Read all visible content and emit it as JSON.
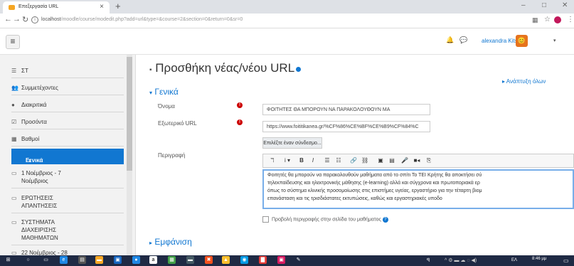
{
  "browser": {
    "tab_title": "Επεξεργασία URL",
    "tab_close": "×",
    "new_tab": "+",
    "url_main": "localhost",
    "url_rest": "/moodle/course/modedit.php?add=url&type=&course=2&section=0&return=0&sr=0",
    "win_min": "–",
    "win_max": "□",
    "win_close": "✕"
  },
  "navbar": {
    "user_name": "alexandra Kitsoy",
    "avatar_letter": "😊"
  },
  "sidebar": {
    "items": [
      {
        "icon": "☰",
        "label": "ΣΤ"
      },
      {
        "icon": "👥",
        "label": "Συμμετέχοντες"
      },
      {
        "icon": "●",
        "label": "Διακριτικά"
      },
      {
        "icon": "☑",
        "label": "Προσόντα"
      },
      {
        "icon": "▦",
        "label": "Βαθμοί"
      },
      {
        "icon": "▭",
        "label": "Γενικά"
      },
      {
        "icon": "▭",
        "label": "1 Νοέμβριος - 7"
      },
      {
        "icon": "",
        "label": "Νοέμβριος"
      },
      {
        "icon": "▭",
        "label": "ΕΡΩΤΗΣΕΙΣ"
      },
      {
        "icon": "",
        "label": "ΑΠΑΝΤΗΣΕΙΣ"
      },
      {
        "icon": "▭",
        "label": "ΣΥΣΤΗΜΑΤΑ"
      },
      {
        "icon": "",
        "label": "ΔΙΑΧΕΙΡΙΣΗΣ"
      },
      {
        "icon": "",
        "label": "ΜΑΘΗΜΑΤΩΝ"
      },
      {
        "icon": "▭",
        "label": "22 Νοέμβριος - 28"
      }
    ]
  },
  "main": {
    "page_title": "Προσθήκη νέας/νέου URL",
    "expand_all": "▸ Ανάπτυξη όλων",
    "section_general": "Γενικά",
    "label_name": "Όνομα",
    "name_value": "ΦΟΙΤΗΤΕΣ ΘΑ ΜΠΟΡΟΥΝ ΝΑ ΠΑΡΑΚΟΛΟΥΘΟΥΝ ΜΑ",
    "label_url": "Εξωτερικό URL",
    "url_value": "https://www.foititikanea.gr/%CF%86%CE%BF%CE%B9%CF%84%C",
    "choose_link": "Επιλέξτε έναν σύνδεσμο...",
    "label_desc": "Περιγραφή",
    "editor_lines": [
      "Φοιτητές θα μπορούν να παρακολουθούν μαθήματα από το σπίτι Το ΤΕΙ Κρήτης θα αποκτήσει σύ",
      "τηλεκπαίδευσης και ηλεκτρονικής μάθησης (e-learning) αλλά και σύγχρονα και πρωτοποριακά ερ",
      "όπως το σύστημα κλινικής προσομοίωσης στις επιστήμες υγείας, εργαστήριο για την τέταρτη βιομ",
      "επανάσταση και τις τρισδιάστατες εκτυπώσεις, καθώς και εργαστηριακές υποδο"
    ],
    "show_desc": "Προβολή περιγραφής στην σελίδα του μαθήματος",
    "section_appearance": "Εμφάνιση"
  },
  "toolbar": {
    "buttons": [
      "ℸ",
      "i ▾",
      "B",
      "I",
      "☰",
      "☷",
      "🔗",
      "⛓",
      "▣",
      "▤",
      "🎤",
      "■◂",
      "⎘"
    ]
  },
  "taskbar": {
    "lang": "ΕΛ",
    "time": "8:46 μμ"
  },
  "colors": {
    "accent": "#1177d1",
    "required": "#cc0000",
    "taskbar": "#1f2a44"
  }
}
